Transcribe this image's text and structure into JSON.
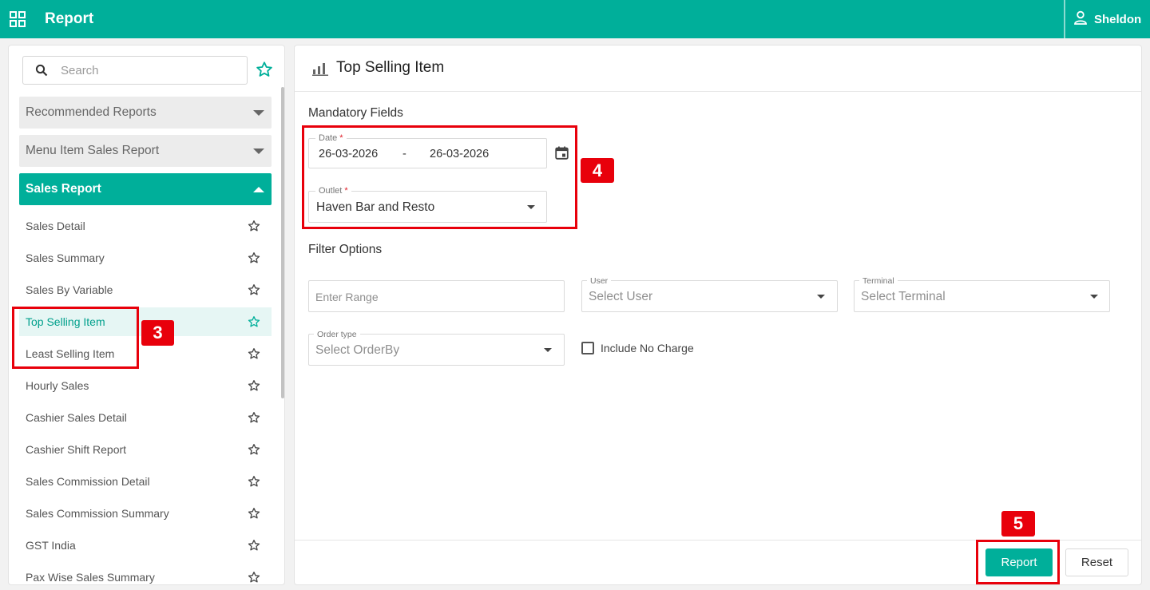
{
  "app": {
    "title": "Report",
    "user": "Sheldon"
  },
  "sidebar": {
    "search_placeholder": "Search",
    "sections": [
      {
        "label": "Recommended Reports",
        "state": "collapsed"
      },
      {
        "label": "Menu Item Sales Report",
        "state": "collapsed"
      },
      {
        "label": "Sales Report",
        "state": "expanded"
      }
    ],
    "items": [
      {
        "label": "Sales Detail"
      },
      {
        "label": "Sales Summary"
      },
      {
        "label": "Sales By Variable"
      },
      {
        "label": "Top Selling Item",
        "active": true
      },
      {
        "label": "Least Selling Item"
      },
      {
        "label": "Hourly Sales"
      },
      {
        "label": "Cashier Sales Detail"
      },
      {
        "label": "Cashier Shift Report"
      },
      {
        "label": "Sales Commission Detail"
      },
      {
        "label": "Sales Commission Summary"
      },
      {
        "label": "GST India"
      },
      {
        "label": "Pax Wise Sales Summary"
      }
    ]
  },
  "main": {
    "title": "Top Selling Item",
    "mandatory_label": "Mandatory Fields",
    "date": {
      "label": "Date",
      "required_mark": "*",
      "from": "26-03-2026",
      "separator": "-",
      "to": "26-03-2026"
    },
    "outlet": {
      "label": "Outlet",
      "required_mark": "*",
      "value": "Haven Bar and Resto"
    },
    "filter_label": "Filter Options",
    "range_placeholder": "Enter Range",
    "user": {
      "label": "User",
      "placeholder": "Select User"
    },
    "terminal": {
      "label": "Terminal",
      "placeholder": "Select Terminal"
    },
    "order_type": {
      "label": "Order type",
      "placeholder": "Select OrderBy"
    },
    "include_no_charge": {
      "label": "Include No Charge",
      "checked": false
    },
    "buttons": {
      "report": "Report",
      "reset": "Reset"
    }
  },
  "annotations": [
    {
      "label": "3"
    },
    {
      "label": "4"
    },
    {
      "label": "5"
    }
  ],
  "colors": {
    "brand": "#00af9a",
    "annotation": "#e8000b",
    "active_item_bg": "#e6f6f4"
  }
}
